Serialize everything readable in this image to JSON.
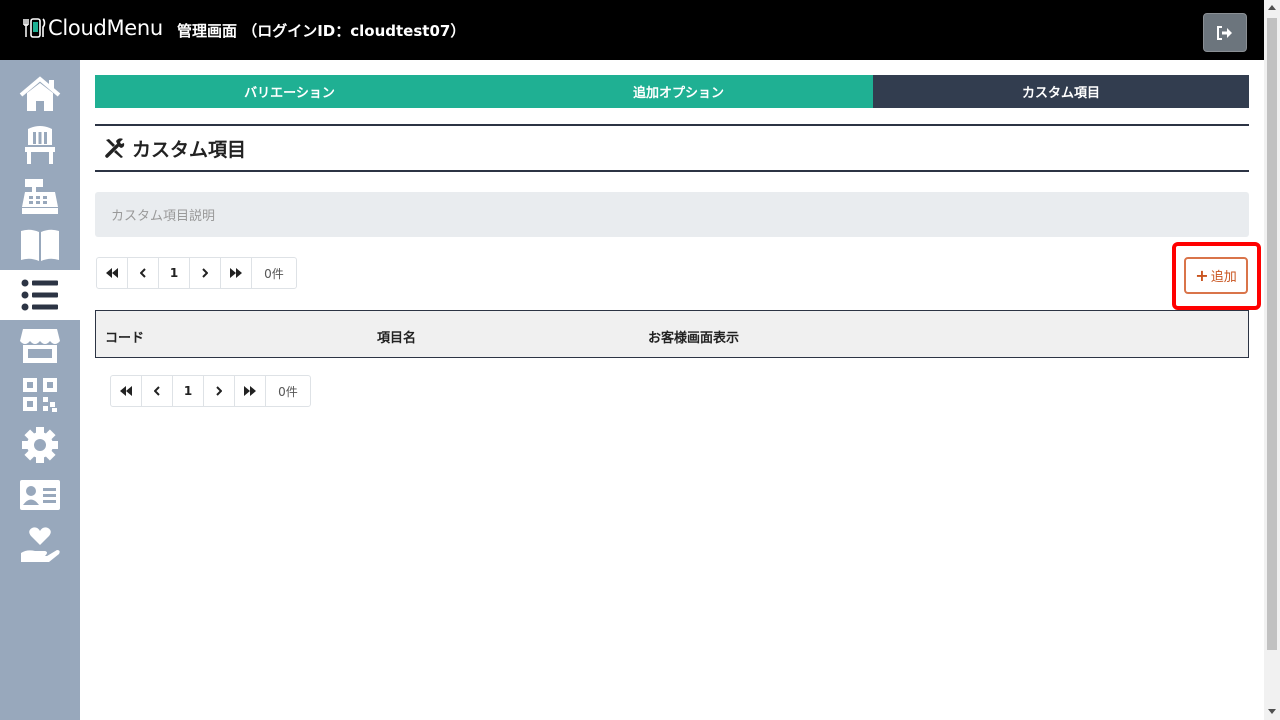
{
  "header": {
    "brand": "CloudMenu",
    "title": "管理画面 （ログインID：cloudtest07）"
  },
  "sidebar": {
    "items": [
      {
        "icon": "home-icon"
      },
      {
        "icon": "chair-icon"
      },
      {
        "icon": "cash-register-icon"
      },
      {
        "icon": "book-icon"
      },
      {
        "icon": "list-icon",
        "active": true
      },
      {
        "icon": "store-icon"
      },
      {
        "icon": "qr-code-icon"
      },
      {
        "icon": "gear-icon"
      },
      {
        "icon": "id-card-icon"
      },
      {
        "icon": "hand-heart-icon"
      }
    ]
  },
  "tabs": [
    {
      "label": "バリエーション"
    },
    {
      "label": "追加オプション"
    },
    {
      "label": "カスタム項目",
      "active": true
    }
  ],
  "section": {
    "title": "カスタム項目"
  },
  "description": {
    "text": "カスタム項目説明"
  },
  "pagination": {
    "first": "«",
    "prev": "‹",
    "page": "1",
    "next": "›",
    "last": "»",
    "count": "0件"
  },
  "actions": {
    "add_label": "追加"
  },
  "table": {
    "columns": [
      "コード",
      "項目名",
      "お客様画面表示"
    ]
  },
  "colors": {
    "tab_active": "#323d4f",
    "tab_inactive": "#1fb093",
    "sidebar": "#98a8bc",
    "add_button": "#c9541f",
    "highlight": "#ff0000"
  }
}
